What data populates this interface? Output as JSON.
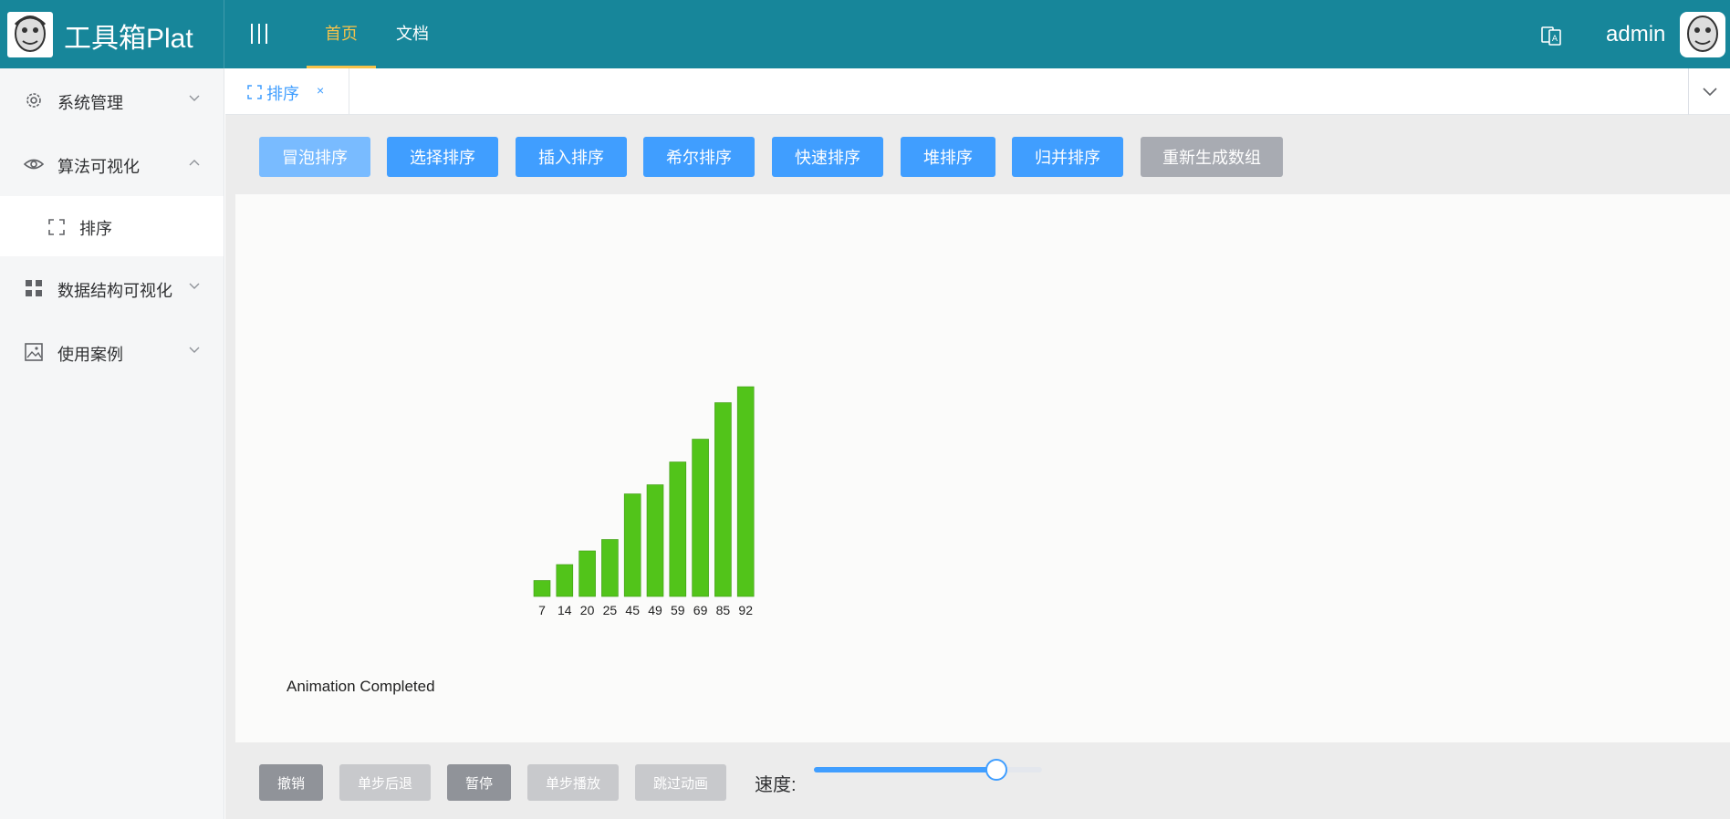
{
  "header": {
    "app_title": "工具箱Plat",
    "nav": [
      {
        "label": "首页",
        "active": true
      },
      {
        "label": "文档",
        "active": false
      }
    ],
    "user_name": "admin",
    "colors": {
      "bar": "#17869a",
      "active_nav": "#f5c24a"
    }
  },
  "sidebar": {
    "items": [
      {
        "label": "系统管理",
        "icon": "gear-icon",
        "expanded": false
      },
      {
        "label": "算法可视化",
        "icon": "eye-icon",
        "expanded": true
      },
      {
        "label": "数据结构可视化",
        "icon": "grid-icon",
        "expanded": false
      },
      {
        "label": "使用案例",
        "icon": "image-icon",
        "expanded": false
      }
    ],
    "sub_items": [
      {
        "label": "排序",
        "icon": "fullscreen-icon",
        "selected": true
      }
    ]
  },
  "tabs": [
    {
      "label": "排序",
      "close": "×"
    }
  ],
  "toolbar": {
    "buttons": [
      {
        "label": "冒泡排序",
        "style": "light"
      },
      {
        "label": "选择排序",
        "style": "primary"
      },
      {
        "label": "插入排序",
        "style": "primary"
      },
      {
        "label": "希尔排序",
        "style": "primary"
      },
      {
        "label": "快速排序",
        "style": "primary"
      },
      {
        "label": "堆排序",
        "style": "primary"
      },
      {
        "label": "归并排序",
        "style": "primary"
      },
      {
        "label": "重新生成数组",
        "style": "gray"
      }
    ]
  },
  "chart_data": {
    "type": "bar",
    "categories": [
      "7",
      "14",
      "20",
      "25",
      "45",
      "49",
      "59",
      "69",
      "85",
      "92"
    ],
    "values": [
      7,
      14,
      20,
      25,
      45,
      49,
      59,
      69,
      85,
      92
    ],
    "title": "",
    "xlabel": "",
    "ylabel": "",
    "color": "#52c41a",
    "grid": false
  },
  "status": "Animation Completed",
  "controls": {
    "buttons": [
      {
        "label": "撤销",
        "state": "dark"
      },
      {
        "label": "单步后退",
        "state": "disabled"
      },
      {
        "label": "暂停",
        "state": "dark"
      },
      {
        "label": "单步播放",
        "state": "disabled"
      },
      {
        "label": "跳过动画",
        "state": "disabled"
      }
    ],
    "speed_label": "速度:",
    "speed_value": 0.8
  }
}
